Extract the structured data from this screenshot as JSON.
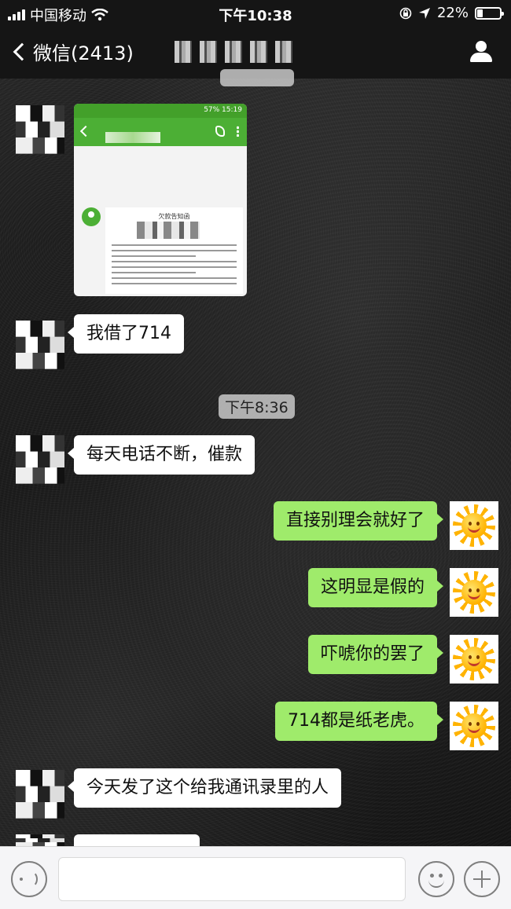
{
  "status_bar": {
    "carrier": "中国移动",
    "time": "下午10:38",
    "battery": "22%",
    "battery_level": 0.22
  },
  "nav": {
    "back_label": "微信(2413)"
  },
  "chat": {
    "time_separator": "下午8:36",
    "messages": [
      {
        "side": "in",
        "text": "我借了714"
      },
      {
        "side": "in",
        "text": "每天电话不断，催款"
      },
      {
        "side": "out",
        "text": "直接别理会就好了"
      },
      {
        "side": "out",
        "text": "这明显是假的"
      },
      {
        "side": "out",
        "text": "吓唬你的罢了"
      },
      {
        "side": "out",
        "text": "714都是纸老虎。"
      },
      {
        "side": "in",
        "text": "今天发了这个给我通讯录里的人"
      }
    ],
    "image_message": {
      "status_bar_text": "57% 15:19",
      "document_title": "欠款告知函"
    }
  },
  "input_bar": {
    "placeholder": ""
  }
}
